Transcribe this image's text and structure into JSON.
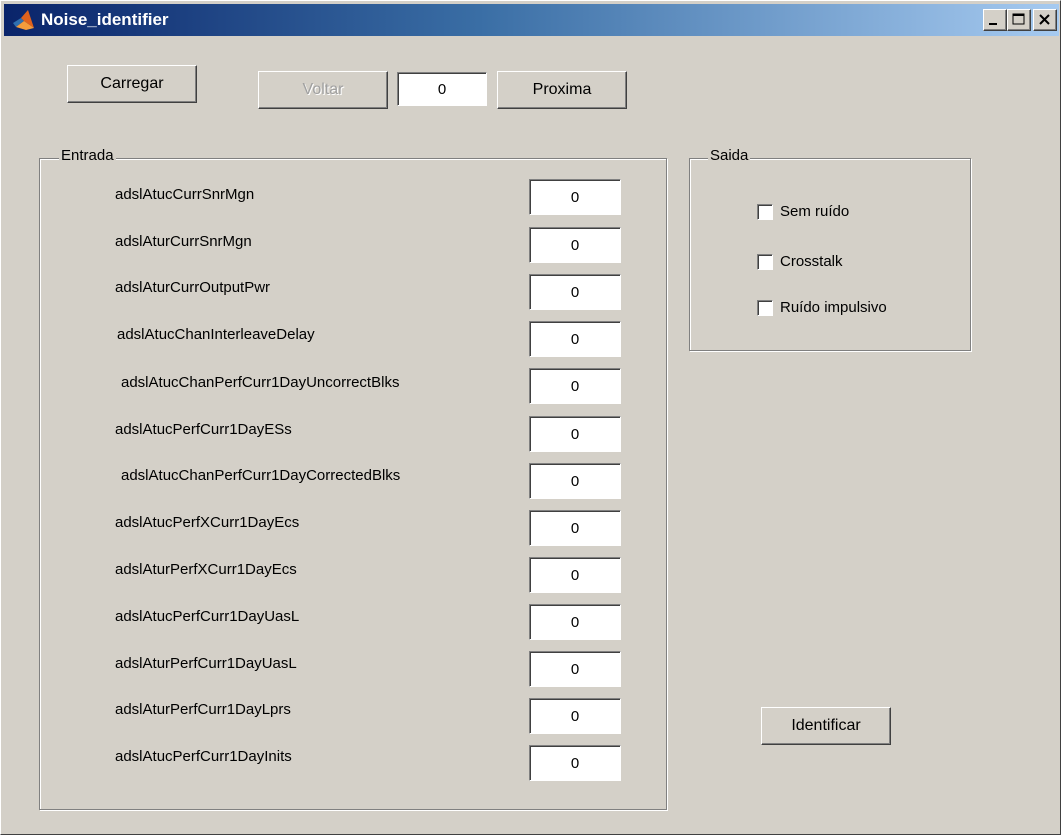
{
  "window": {
    "title": "Noise_identifier"
  },
  "toolbar": {
    "load_label": "Carregar",
    "back_label": "Voltar",
    "index_value": "0",
    "next_label": "Proxima"
  },
  "entrada": {
    "title": "Entrada",
    "rows": [
      {
        "label": "adslAtucCurrSnrMgn",
        "value": "0"
      },
      {
        "label": "adslAturCurrSnrMgn",
        "value": "0"
      },
      {
        "label": "adslAturCurrOutputPwr",
        "value": "0"
      },
      {
        "label": "adslAtucChanInterleaveDelay",
        "value": "0"
      },
      {
        "label": "adslAtucChanPerfCurr1DayUncorrectBlks",
        "value": "0"
      },
      {
        "label": "adslAtucPerfCurr1DayESs",
        "value": "0"
      },
      {
        "label": "adslAtucChanPerfCurr1DayCorrectedBlks",
        "value": "0"
      },
      {
        "label": "adslAtucPerfXCurr1DayEcs",
        "value": "0"
      },
      {
        "label": "adslAturPerfXCurr1DayEcs",
        "value": "0"
      },
      {
        "label": "adslAtucPerfCurr1DayUasL",
        "value": "0"
      },
      {
        "label": "adslAturPerfCurr1DayUasL",
        "value": "0"
      },
      {
        "label": "adslAturPerfCurr1DayLprs",
        "value": "0"
      },
      {
        "label": "adslAtucPerfCurr1DayInits",
        "value": "0"
      }
    ]
  },
  "saida": {
    "title": "Saida",
    "options": [
      {
        "label": "Sem ruído",
        "checked": false
      },
      {
        "label": "Crosstalk",
        "checked": false
      },
      {
        "label": "Ruído impulsivo",
        "checked": false
      }
    ]
  },
  "actions": {
    "identify_label": "Identificar"
  },
  "icons": {
    "app": "matlab-logo-icon",
    "minimize": "minimize-icon",
    "maximize": "maximize-icon",
    "close": "close-icon"
  },
  "colors": {
    "window_bg": "#d4d0c8",
    "title_start": "#0a246a",
    "title_end": "#a6caf0",
    "disabled_text": "#a0a0a0"
  }
}
